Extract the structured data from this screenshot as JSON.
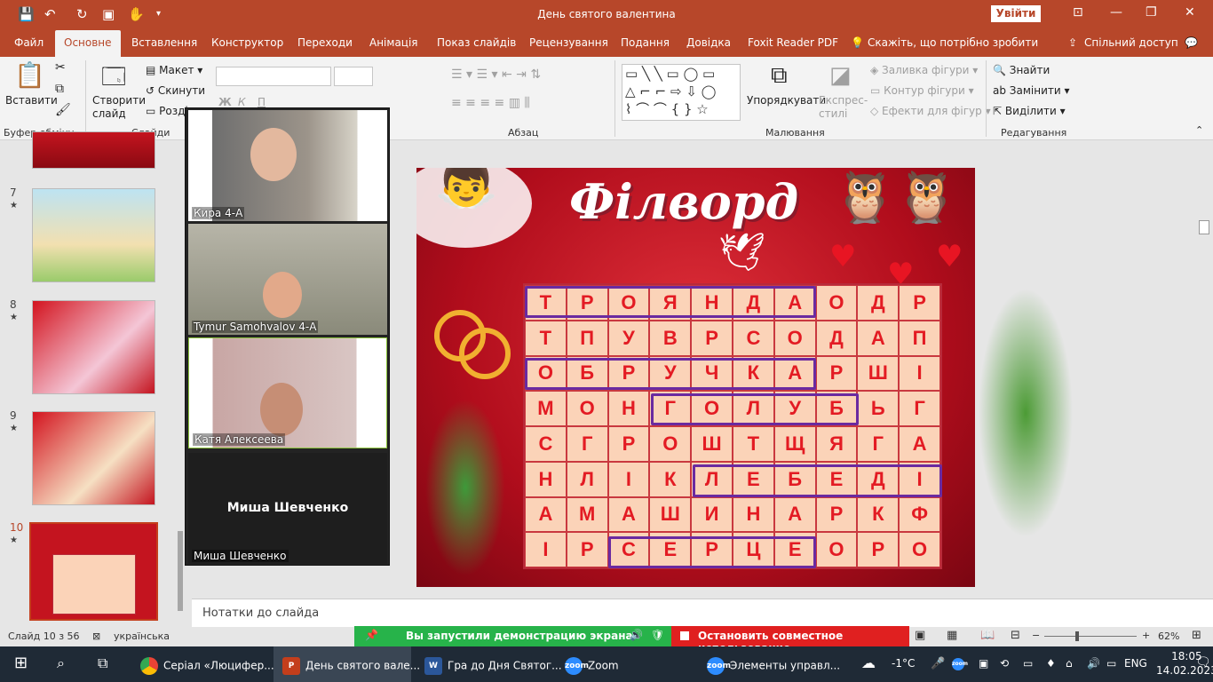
{
  "window": {
    "title": "День святого валентина",
    "signin": "Увійти"
  },
  "menu": {
    "tabs": [
      "Файл",
      "Основне",
      "Вставлення",
      "Конструктор",
      "Переходи",
      "Анімація",
      "Показ слайдів",
      "Рецензування",
      "Подання",
      "Довідка",
      "Foxit Reader PDF"
    ],
    "search": "Скажіть, що потрібно зробити",
    "share": "Спільний доступ"
  },
  "ribbon": {
    "paste": "Вставити",
    "new_slide": "Створити слайд",
    "layout": "Макет",
    "reset": "Скинути",
    "section": "Розділ",
    "arrange": "Упорядкувати",
    "quick_styles": "Експрес-стилі",
    "shape_fill": "Заливка фігури",
    "shape_outline": "Контур фігури",
    "shape_effects": "Ефекти для фігур",
    "find": "Знайти",
    "replace": "Замінити",
    "select": "Виділити",
    "groups": {
      "clipboard": "Буфер обміну",
      "slides": "Слайди",
      "paragraph": "Абзац",
      "drawing": "Малювання",
      "editing": "Редагування"
    }
  },
  "thumbnails": [
    {
      "num": "7",
      "star": "★"
    },
    {
      "num": "8",
      "star": "★"
    },
    {
      "num": "9",
      "star": "★"
    },
    {
      "num": "10",
      "star": "★"
    }
  ],
  "slide": {
    "title": "Філворд",
    "grid": [
      [
        "Т",
        "Р",
        "О",
        "Я",
        "Н",
        "Д",
        "А",
        "О",
        "Д",
        "Р"
      ],
      [
        "Т",
        "П",
        "У",
        "В",
        "Р",
        "С",
        "О",
        "Д",
        "А",
        "П"
      ],
      [
        "О",
        "Б",
        "Р",
        "У",
        "Ч",
        "К",
        "А",
        "Р",
        "Ш",
        "І"
      ],
      [
        "М",
        "О",
        "Н",
        "Г",
        "О",
        "Л",
        "У",
        "Б",
        "Ь",
        "Г"
      ],
      [
        "С",
        "Г",
        "Р",
        "О",
        "Ш",
        "Т",
        "Щ",
        "Я",
        "Г",
        "А"
      ],
      [
        "Н",
        "Л",
        "І",
        "К",
        "Л",
        "Е",
        "Б",
        "Е",
        "Д",
        "І"
      ],
      [
        "А",
        "М",
        "А",
        "Ш",
        "И",
        "Н",
        "А",
        "Р",
        "К",
        "Ф"
      ],
      [
        "І",
        "Р",
        "С",
        "Е",
        "Р",
        "Ц",
        "Е",
        "О",
        "Р",
        "О"
      ]
    ],
    "found_words": [
      {
        "row": 0,
        "start": 0,
        "end": 6
      },
      {
        "row": 2,
        "start": 0,
        "end": 6
      },
      {
        "row": 3,
        "start": 3,
        "end": 7
      },
      {
        "row": 5,
        "start": 4,
        "end": 9
      },
      {
        "row": 7,
        "start": 2,
        "end": 6
      }
    ],
    "highlight_color": "#6a2aa0",
    "letter_color": "#e31b23"
  },
  "notes_placeholder": "Нотатки до слайда",
  "zoom": {
    "participants": [
      "Кира 4-А",
      "Tymur Samohvalov 4-А",
      "Катя Алексеева",
      "Миша Шевченко"
    ],
    "center_name": "Миша Шевченко"
  },
  "share_bar": {
    "message": "Вы запустили демонстрацию экрана",
    "stop": "Остановить совместное использование"
  },
  "status": {
    "slide_counter": "Слайд 10 з 56",
    "language": "українська",
    "zoom_level": "62%"
  },
  "taskbar": {
    "apps": [
      "Серіал «Люцифер...",
      "День святого вале...",
      "Гра  до Дня Святог...",
      "Zoom",
      "Элементы управл..."
    ],
    "weather": "-1°C",
    "lang": "ENG",
    "time": "18:05",
    "date": "14.02.2023"
  }
}
